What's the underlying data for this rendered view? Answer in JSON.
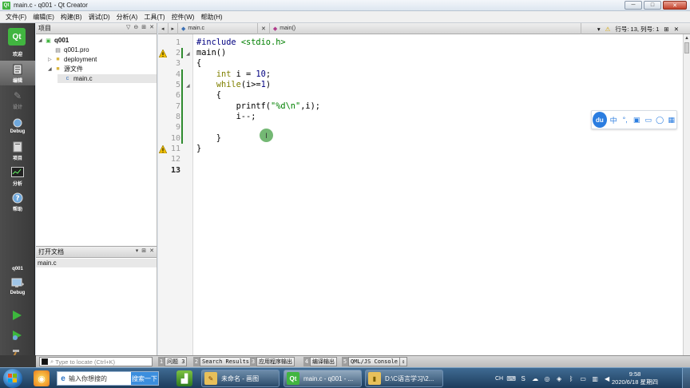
{
  "window": {
    "title": "main.c - q001 - Qt Creator",
    "controls": {
      "minimize": "─",
      "maximize": "□",
      "close": "✕"
    }
  },
  "menubar": [
    "文件(F)",
    "编辑(E)",
    "构建(B)",
    "调试(D)",
    "分析(A)",
    "工具(T)",
    "控件(W)",
    "帮助(H)"
  ],
  "modebar": {
    "logo": "Qt",
    "modes": [
      {
        "label": "欢迎",
        "icon": "welcome-icon"
      },
      {
        "label": "编辑",
        "icon": "edit-icon",
        "active": true
      },
      {
        "label": "设计",
        "icon": "design-icon",
        "disabled": true
      },
      {
        "label": "Debug",
        "icon": "debug-icon"
      },
      {
        "label": "项目",
        "icon": "project-icon"
      },
      {
        "label": "分析",
        "icon": "analyze-icon"
      },
      {
        "label": "帮助",
        "icon": "help-icon"
      }
    ],
    "target": {
      "project": "q001",
      "config": "Debug"
    }
  },
  "project_panel": {
    "title": "项目",
    "tree": [
      {
        "label": "q001",
        "depth": 0,
        "icon": "qt-project-icon",
        "expanded": true,
        "bold": true
      },
      {
        "label": "q001.pro",
        "depth": 1,
        "icon": "pro-file-icon"
      },
      {
        "label": "deployment",
        "depth": 1,
        "icon": "folder-icon",
        "expandable": true
      },
      {
        "label": "源文件",
        "depth": 1,
        "icon": "source-folder-icon",
        "expanded": true
      },
      {
        "label": "main.c",
        "depth": 2,
        "icon": "c-file-icon",
        "selected": true
      }
    ]
  },
  "open_docs": {
    "title": "打开文档",
    "items": [
      "main.c"
    ]
  },
  "editor_toolbar": {
    "file": "main.c",
    "symbol": "main()",
    "position": "行号: 13, 列号: 1"
  },
  "editor": {
    "line_numbers": [
      "1",
      "2",
      "3",
      "4",
      "5",
      "6",
      "7",
      "8",
      "9",
      "10",
      "11",
      "12",
      "13"
    ],
    "current_line": 13,
    "warnings_on_lines": [
      2,
      11
    ]
  },
  "ime": {
    "logo": "du",
    "mode": "中",
    "punct": "°,"
  },
  "output_bar": {
    "locate_placeholder": "Type to locate (Ctrl+K)",
    "panes": [
      {
        "num": "1",
        "label": "问题 3"
      },
      {
        "num": "2",
        "label": "Search Results"
      },
      {
        "num": "3",
        "label": "应用程序输出"
      },
      {
        "num": "4",
        "label": "编译输出"
      },
      {
        "num": "5",
        "label": "QML/JS Console"
      }
    ]
  },
  "taskbar": {
    "search_placeholder": "输入你想搜的",
    "search_button": "搜索一下",
    "tasks": [
      {
        "label": "未命名 - 画图"
      },
      {
        "label": "main.c - q001 - ..."
      },
      {
        "label": "D:\\C语言学习\\2..."
      }
    ],
    "tray_lang": "CH",
    "time": "9:58",
    "date": "2020/6/18 星期四"
  }
}
